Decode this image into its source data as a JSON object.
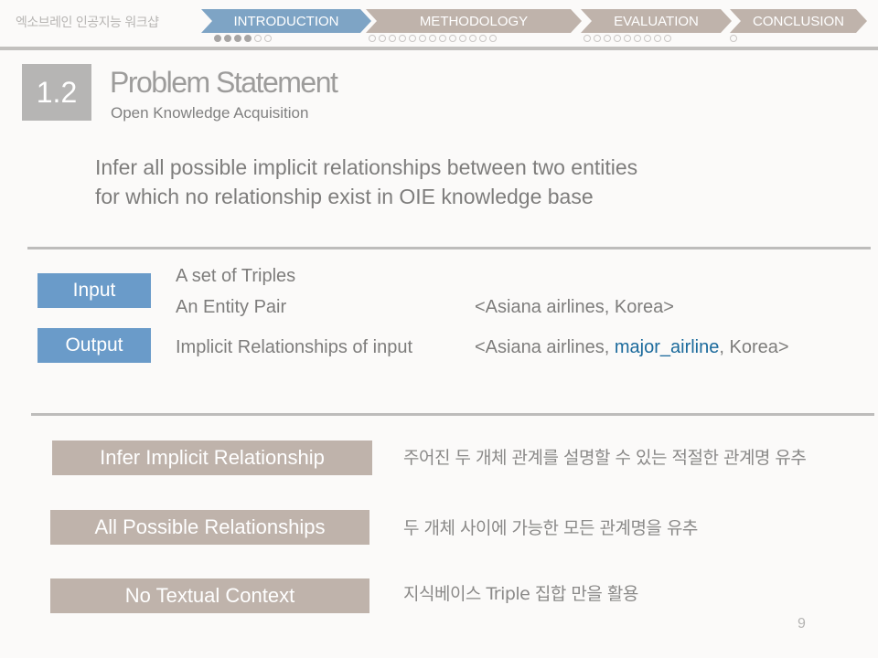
{
  "header": {
    "workshop_title": "엑소브레인 인공지능 워크샵",
    "tabs": [
      {
        "label": "INTRODUCTION",
        "active": true,
        "dots_filled": 4,
        "dots_total": 6
      },
      {
        "label": "METHODOLOGY",
        "active": false,
        "dots_filled": 0,
        "dots_total": 13
      },
      {
        "label": "EVALUATION",
        "active": false,
        "dots_filled": 0,
        "dots_total": 9
      },
      {
        "label": "CONCLUSION",
        "active": false,
        "dots_filled": 0,
        "dots_total": 1
      }
    ]
  },
  "section": {
    "number": "1.2",
    "title": "Problem Statement",
    "subtitle": "Open Knowledge Acquisition"
  },
  "statement": {
    "line1": "Infer all possible implicit relationships between two entities",
    "line2": "for which no relationship exist in OIE knowledge base"
  },
  "io": {
    "input_label": "Input",
    "output_label": "Output",
    "input_items": [
      "A set of Triples",
      "An Entity Pair"
    ],
    "input_example": "<Asiana airlines, Korea>",
    "output_item": "Implicit Relationships of input",
    "output_example_prefix": "<Asiana airlines, ",
    "output_example_highlight": "major_airline",
    "output_example_suffix": ", Korea>"
  },
  "features": [
    {
      "label": "Infer Implicit Relationship",
      "description": "주어진 두 개체 관계를 설명할 수 있는 적절한 관계명 유추"
    },
    {
      "label": "All Possible Relationships",
      "description": "두 개체 사이에 가능한 모든 관계명을 유추"
    },
    {
      "label": "No Textual Context",
      "description": "지식베이스 Triple 집합 만을 활용"
    }
  ],
  "colors": {
    "active_tab": "#7ea4c5",
    "inactive_tab": "#bfb3ab",
    "io_label": "#6a9bc9",
    "highlight": "#1b6a9c"
  },
  "page_number": "9"
}
